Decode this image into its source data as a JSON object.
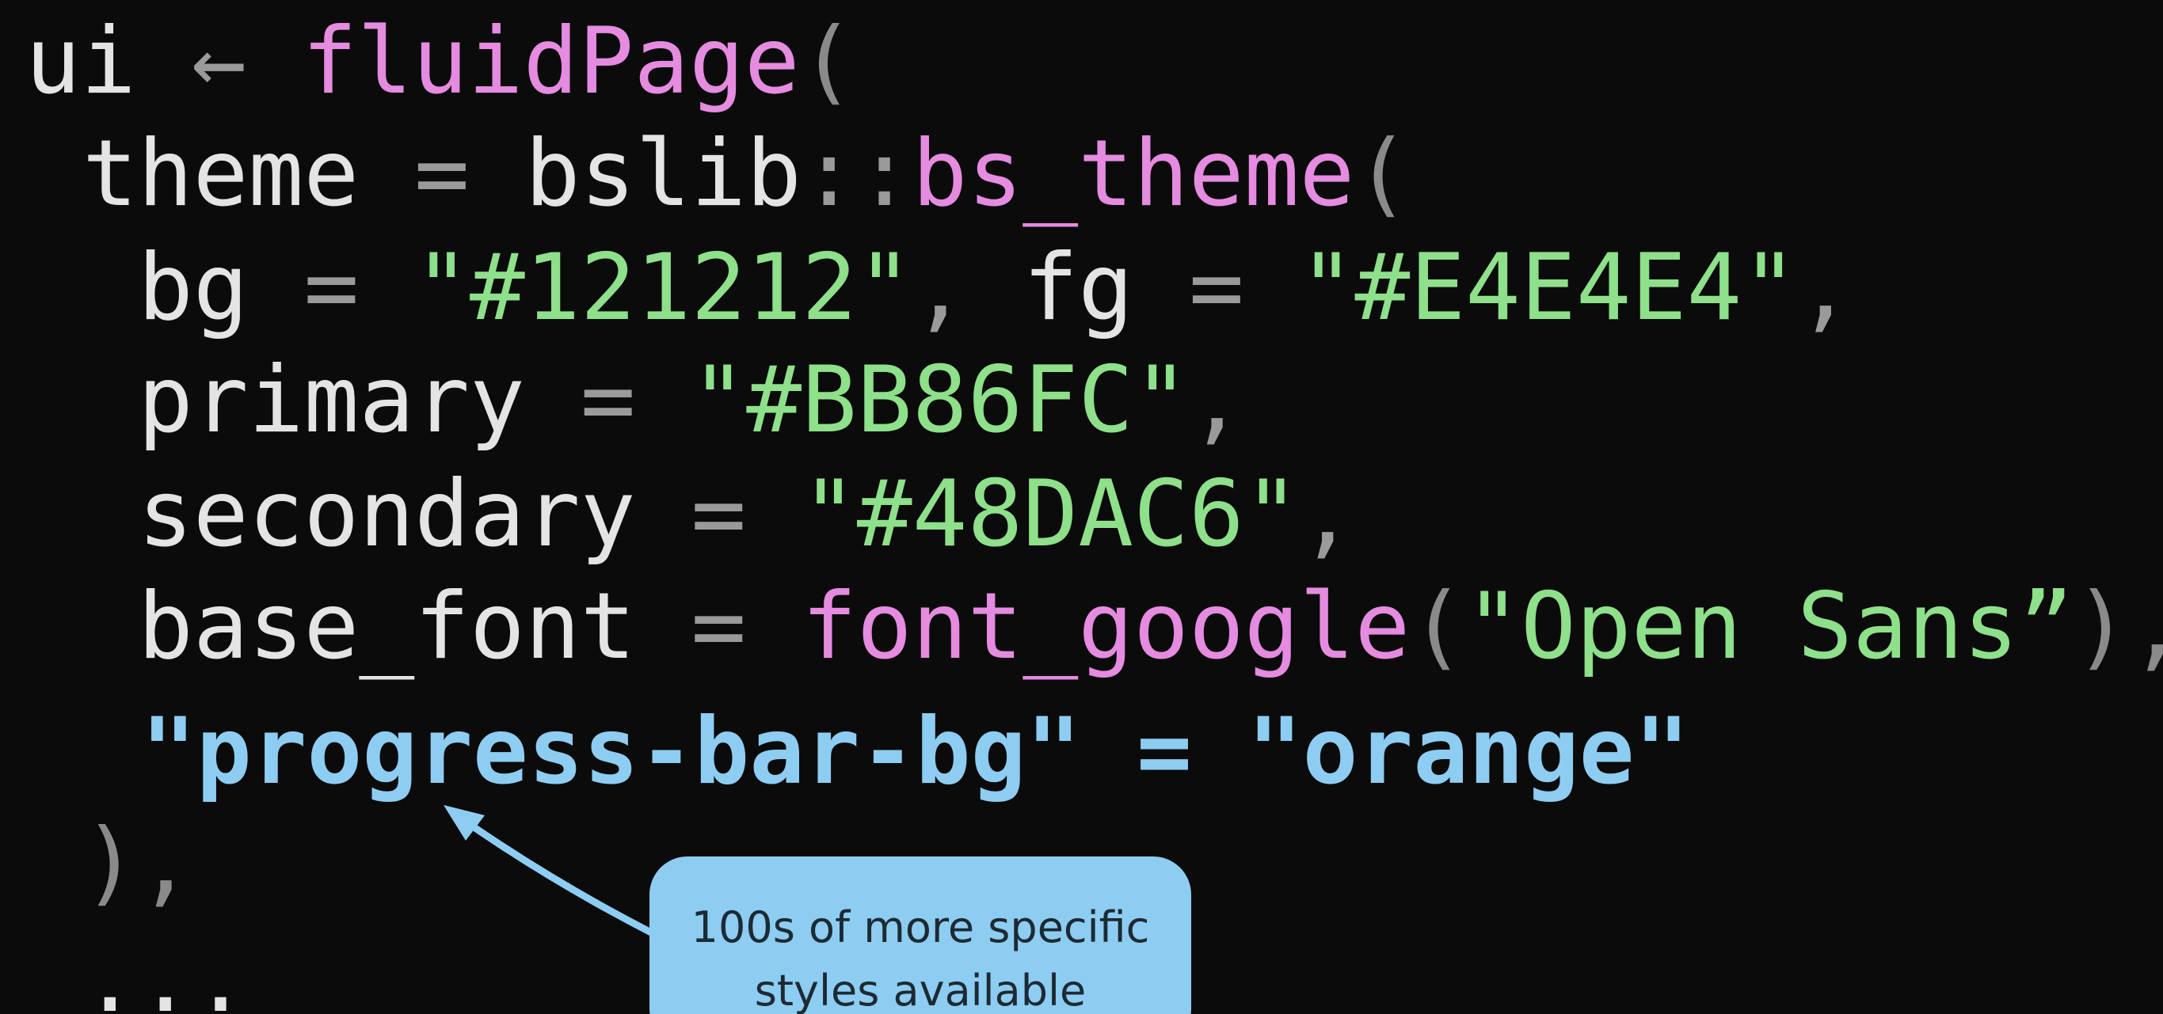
{
  "code": {
    "lines": [
      {
        "indent": 0,
        "tokens": [
          {
            "text": "ui ",
            "kind": "plain"
          },
          {
            "text": "← ",
            "kind": "op"
          },
          {
            "text": "fluidPage",
            "kind": "fn"
          },
          {
            "text": "(",
            "kind": "paren"
          }
        ]
      },
      {
        "indent": 1,
        "tokens": [
          {
            "text": "theme ",
            "kind": "plain"
          },
          {
            "text": "= ",
            "kind": "op"
          },
          {
            "text": "bslib",
            "kind": "plain"
          },
          {
            "text": "::",
            "kind": "op"
          },
          {
            "text": "bs_theme",
            "kind": "fn"
          },
          {
            "text": "(",
            "kind": "paren"
          }
        ]
      },
      {
        "indent": 2,
        "tokens": [
          {
            "text": "bg ",
            "kind": "plain"
          },
          {
            "text": "= ",
            "kind": "op"
          },
          {
            "text": "\"#121212\"",
            "kind": "str"
          },
          {
            "text": ", ",
            "kind": "op"
          },
          {
            "text": "fg ",
            "kind": "plain"
          },
          {
            "text": "= ",
            "kind": "op"
          },
          {
            "text": "\"#E4E4E4\"",
            "kind": "str"
          },
          {
            "text": ",",
            "kind": "op"
          }
        ]
      },
      {
        "indent": 2,
        "tokens": [
          {
            "text": "primary ",
            "kind": "plain"
          },
          {
            "text": "= ",
            "kind": "op"
          },
          {
            "text": "\"#BB86FC\"",
            "kind": "str"
          },
          {
            "text": ",",
            "kind": "op"
          }
        ]
      },
      {
        "indent": 2,
        "tokens": [
          {
            "text": "secondary ",
            "kind": "plain"
          },
          {
            "text": "= ",
            "kind": "op"
          },
          {
            "text": "\"#48DAC6\"",
            "kind": "str"
          },
          {
            "text": ",",
            "kind": "op"
          }
        ]
      },
      {
        "indent": 2,
        "tokens": [
          {
            "text": "base_font ",
            "kind": "plain"
          },
          {
            "text": "= ",
            "kind": "op"
          },
          {
            "text": "font_google",
            "kind": "fn"
          },
          {
            "text": "(",
            "kind": "paren"
          },
          {
            "text": "\"Open Sans”",
            "kind": "str"
          },
          {
            "text": "),",
            "kind": "paren"
          }
        ]
      },
      {
        "indent": 2,
        "tokens": [
          {
            "text": "\"progress-bar-bg\" = \"orange\"",
            "kind": "hl"
          }
        ]
      },
      {
        "indent": 1,
        "tokens": [
          {
            "text": "),",
            "kind": "paren"
          }
        ]
      },
      {
        "indent": 1,
        "tokens": [
          {
            "text": "...",
            "kind": "plain"
          }
        ]
      }
    ]
  },
  "callout": {
    "line1": "100s of more specific",
    "line2": "styles available"
  },
  "colors": {
    "background": "#0b0b0b",
    "plain": "#e4e4e4",
    "operator": "#9a9a9a",
    "function": "#e58be0",
    "string": "#8ee08a",
    "highlight": "#8ecdf2"
  }
}
